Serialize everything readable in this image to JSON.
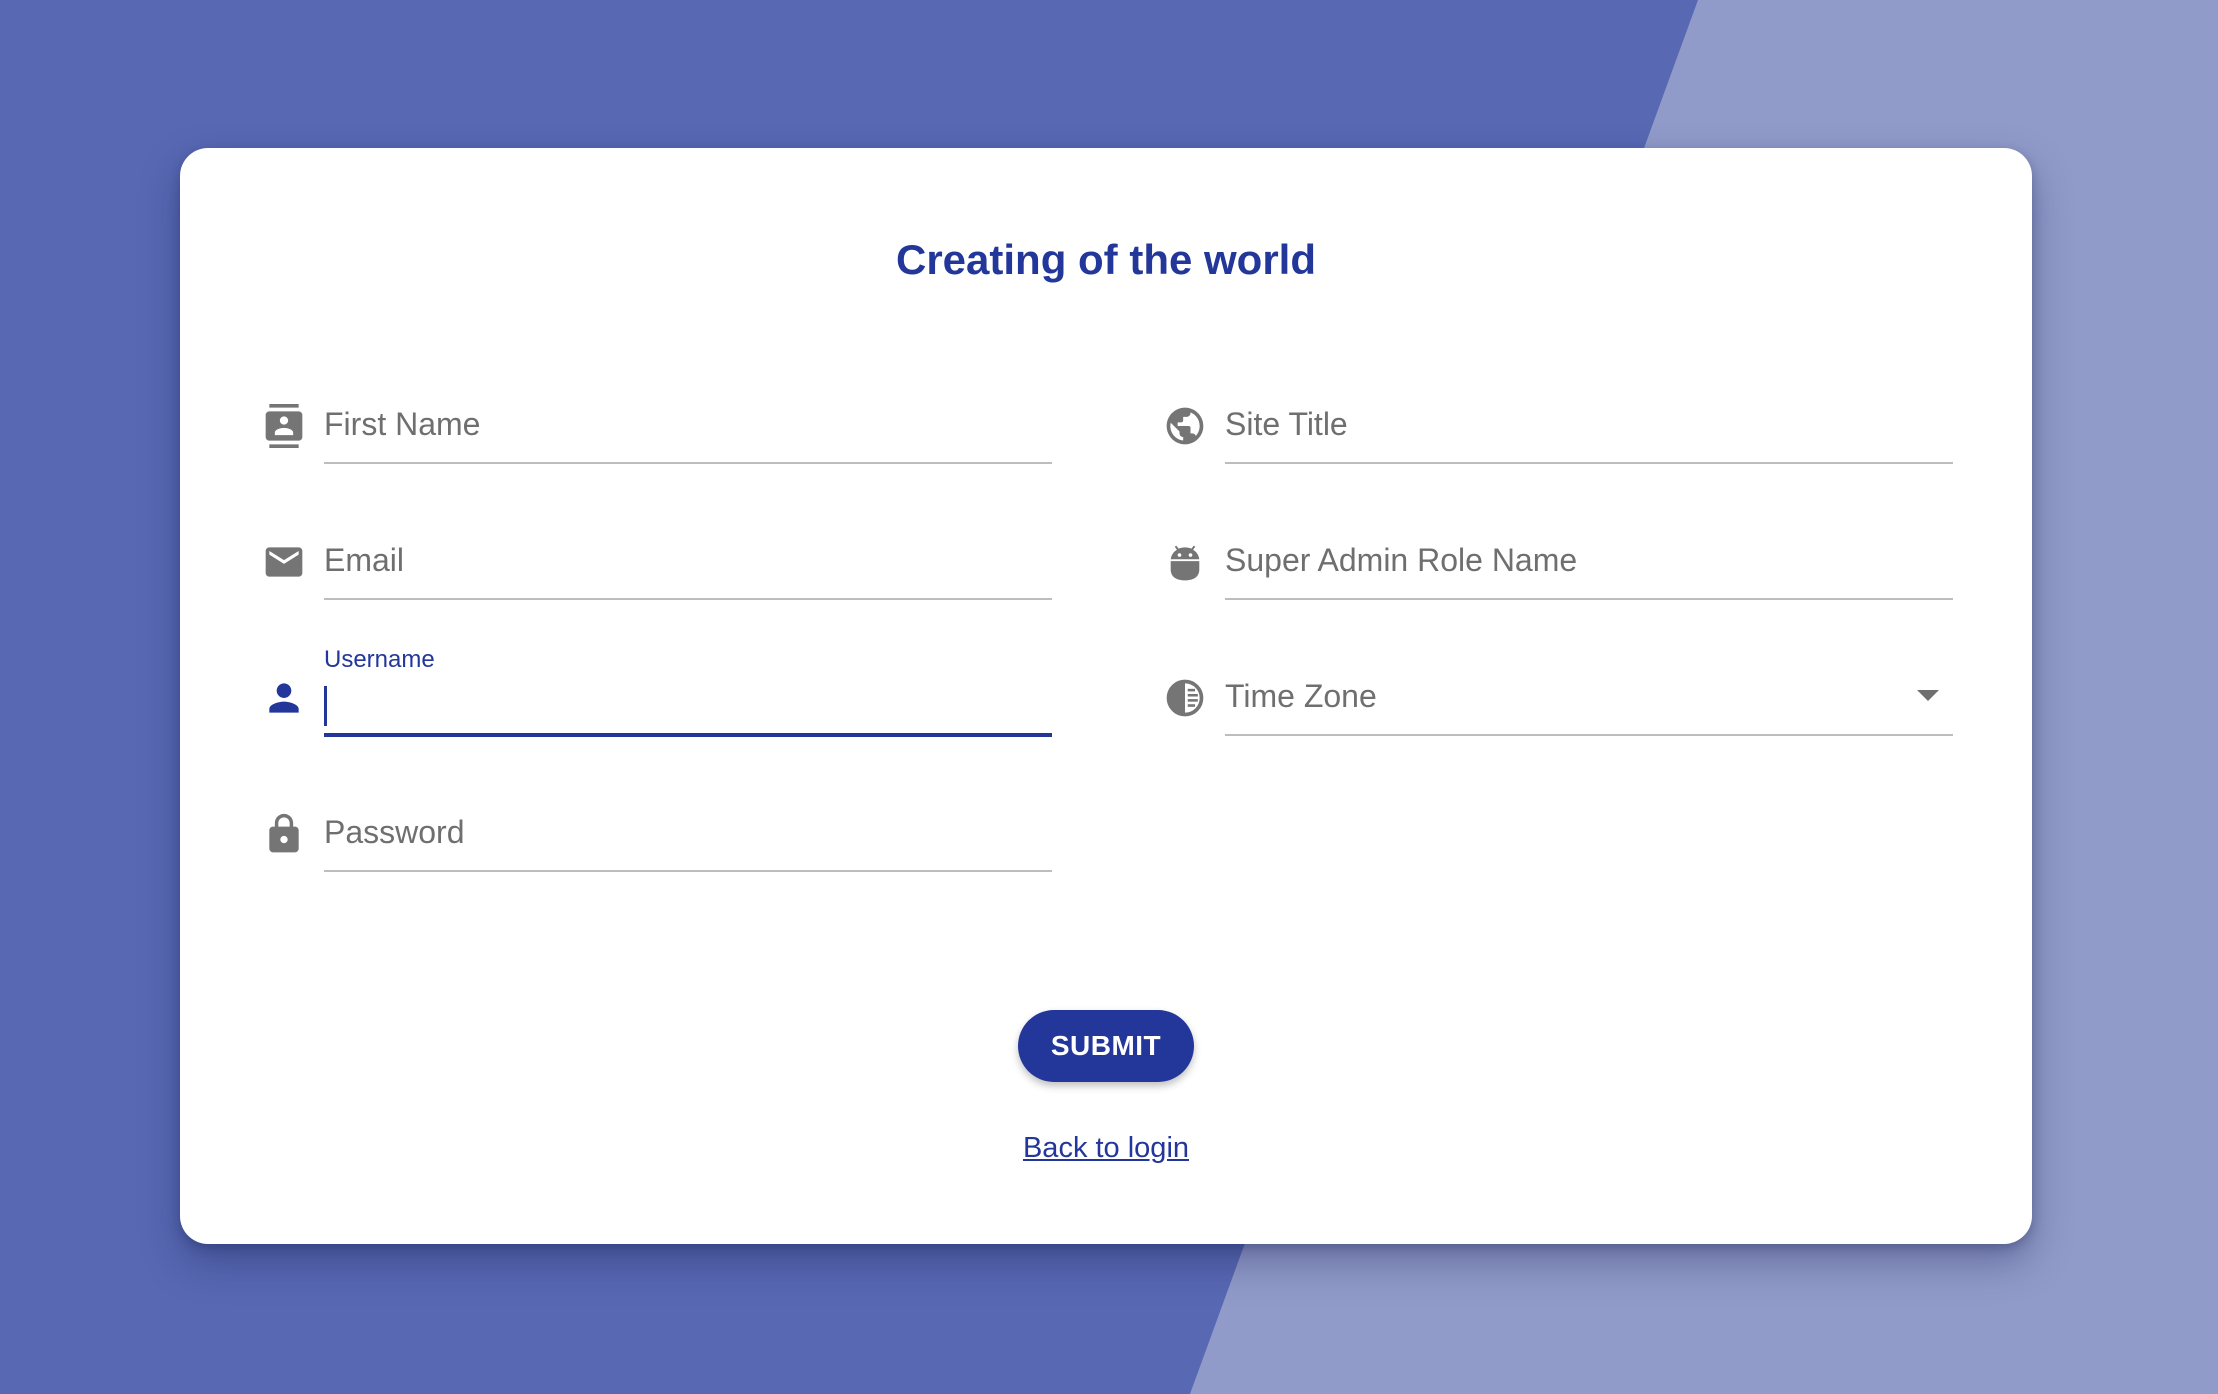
{
  "colors": {
    "background": "#5868b3",
    "background_light": "#919bc9",
    "accent": "#23369a",
    "card": "#ffffff",
    "icon_gray": "#757575"
  },
  "form": {
    "title": "Creating of the world",
    "left_fields": [
      {
        "icon": "contact-card-icon",
        "placeholder": "First Name"
      },
      {
        "icon": "mail-icon",
        "placeholder": "Email"
      },
      {
        "icon": "person-icon",
        "label": "Username",
        "value": ""
      },
      {
        "icon": "lock-icon",
        "placeholder": "Password"
      }
    ],
    "right_fields": [
      {
        "icon": "globe-icon",
        "placeholder": "Site Title"
      },
      {
        "icon": "android-icon",
        "placeholder": "Super Admin Role Name"
      },
      {
        "icon": "timezone-icon",
        "placeholder": "Time Zone"
      }
    ],
    "submit_label": "SUBMIT",
    "back_link": "Back to login"
  }
}
